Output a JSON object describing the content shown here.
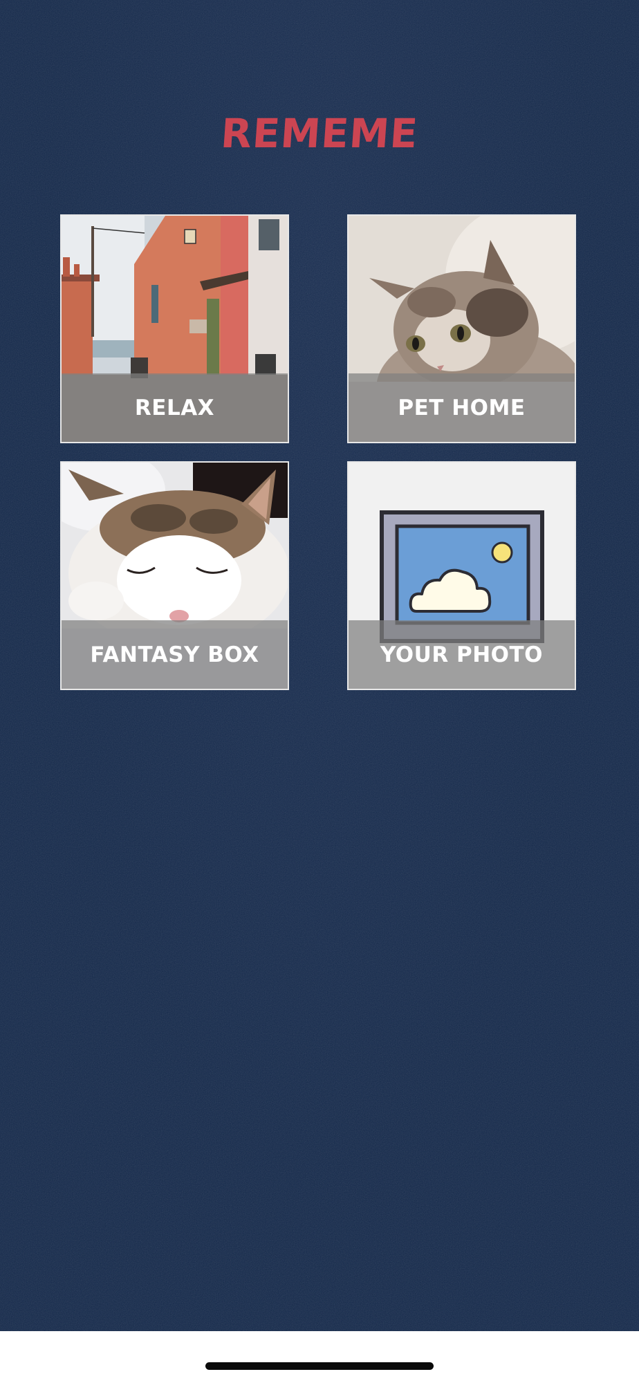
{
  "app": {
    "title": "REMEME"
  },
  "tiles": [
    {
      "id": "relax",
      "label": "RELAX",
      "icon": "street-photo"
    },
    {
      "id": "pet-home",
      "label": "PET HOME",
      "icon": "kitten-photo"
    },
    {
      "id": "fantasy-box",
      "label": "FANTASY BOX",
      "icon": "sleeping-cat-photo"
    },
    {
      "id": "your-photo",
      "label": "YOUR PHOTO",
      "icon": "image-placeholder-icon"
    }
  ],
  "colors": {
    "background": "#13284a",
    "title": "#cc4552",
    "caption_overlay": "#808080",
    "tile_border": "#e8e8e8"
  }
}
